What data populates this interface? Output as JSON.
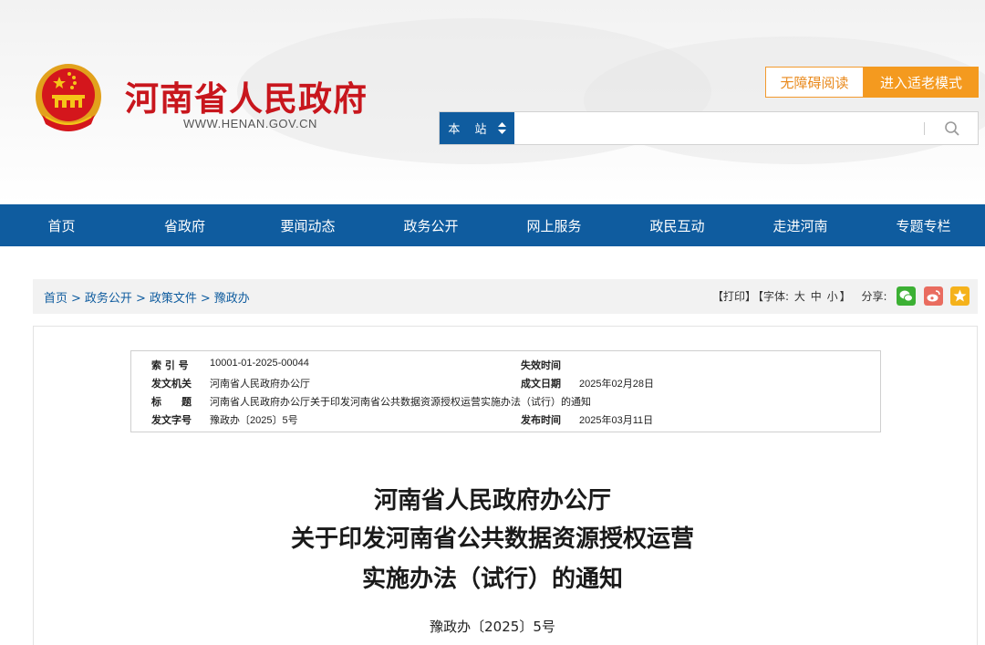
{
  "header": {
    "site_name": "河南省人民政府",
    "site_url": "WWW.HENAN.GOV.CN",
    "accessibility_button": "无障碍阅读",
    "elder_mode_button": "进入适老模式",
    "search": {
      "scope": "本 站",
      "placeholder": ""
    }
  },
  "nav": {
    "items": [
      "首页",
      "省政府",
      "要闻动态",
      "政务公开",
      "网上服务",
      "政民互动",
      "走进河南",
      "专题专栏"
    ]
  },
  "breadcrumb": {
    "items": [
      "首页",
      "政务公开",
      "政策文件",
      "豫政办"
    ],
    "separator": ">"
  },
  "tools": {
    "print": "【打印】",
    "font_label": "【字体:",
    "font_large": "大",
    "font_medium": "中",
    "font_small": "小",
    "font_close": "】",
    "share_label": "分享:",
    "share_icons": [
      "wechat-icon",
      "weibo-icon",
      "qzone-icon"
    ]
  },
  "meta": {
    "index_label": "索 引 号",
    "index_value": "10001-01-2025-00044",
    "expire_label": "失效时间",
    "expire_value": "",
    "issuer_label": "发文机关",
    "issuer_value": "河南省人民政府办公厅",
    "created_label": "成文日期",
    "created_value": "2025年02月28日",
    "title_label": "标　　题",
    "title_value": "河南省人民政府办公厅关于印发河南省公共数据资源授权运营实施办法（试行）的通知",
    "docno_label": "发文字号",
    "docno_value": "豫政办〔2025〕5号",
    "publish_label": "发布时间",
    "publish_value": "2025年03月11日"
  },
  "document": {
    "title_line1": "河南省人民政府办公厅",
    "title_line2": "关于印发河南省公共数据资源授权运营",
    "title_line3": "实施办法（试行）的通知",
    "doc_number": "豫政办〔2025〕5号"
  },
  "colors": {
    "brand_red": "#c8161d",
    "nav_blue": "#0f5c9f",
    "accent_orange": "#f49a1f"
  }
}
